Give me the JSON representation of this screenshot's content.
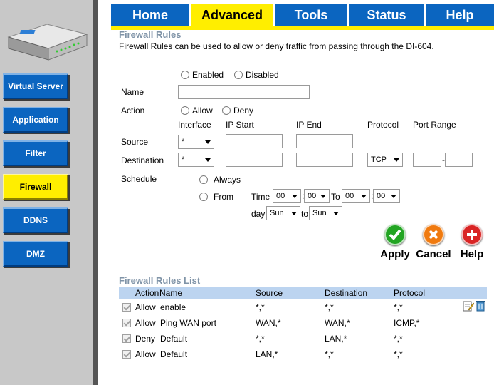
{
  "tabs": [
    {
      "label": "Home",
      "active": false
    },
    {
      "label": "Advanced",
      "active": true
    },
    {
      "label": "Tools",
      "active": false
    },
    {
      "label": "Status",
      "active": false
    },
    {
      "label": "Help",
      "active": false
    }
  ],
  "sidebar": {
    "items": [
      {
        "label": "Virtual Server",
        "active": false
      },
      {
        "label": "Application",
        "active": false
      },
      {
        "label": "Filter",
        "active": false
      },
      {
        "label": "Firewall",
        "active": true
      },
      {
        "label": "DDNS",
        "active": false
      },
      {
        "label": "DMZ",
        "active": false
      }
    ]
  },
  "rules": {
    "title": "Firewall Rules",
    "description": "Firewall Rules can be used to allow or deny traffic from passing through the DI-604.",
    "enabled_label": "Enabled",
    "disabled_label": "Disabled",
    "name_label": "Name",
    "name_value": "",
    "action_label": "Action",
    "allow_label": "Allow",
    "deny_label": "Deny",
    "col_interface": "Interface",
    "col_ip_start": "IP Start",
    "col_ip_end": "IP End",
    "col_protocol": "Protocol",
    "col_port_range": "Port Range",
    "source_label": "Source",
    "destination_label": "Destination",
    "source_interface": "*",
    "dest_interface": "*",
    "dest_protocol": "TCP",
    "port_dash": "-",
    "schedule_label": "Schedule",
    "always_label": "Always",
    "from_label": "From",
    "time_label": "Time",
    "time_from_hour": "00",
    "time_from_min": "00",
    "to_label": "To",
    "time_to_hour": "00",
    "time_to_min": "00",
    "day_label": "day",
    "day_from": "Sun",
    "day_to_label": "to",
    "day_to": "Sun",
    "colon": ":"
  },
  "actions": {
    "apply": "Apply",
    "cancel": "Cancel",
    "help": "Help"
  },
  "list": {
    "title": "Firewall Rules List",
    "headers": {
      "action": "Action",
      "name": "Name",
      "source": "Source",
      "destination": "Destination",
      "protocol": "Protocol"
    },
    "rows": [
      {
        "action": "Allow",
        "name": "enable",
        "source": "*,*",
        "destination": "*,*",
        "protocol": "*,*"
      },
      {
        "action": "Allow",
        "name": "Ping WAN port",
        "source": "WAN,*",
        "destination": "WAN,*",
        "protocol": "ICMP,*"
      },
      {
        "action": "Deny",
        "name": "Default",
        "source": "*,*",
        "destination": "LAN,*",
        "protocol": "*,*"
      },
      {
        "action": "Allow",
        "name": "Default",
        "source": "LAN,*",
        "destination": "*,*",
        "protocol": "*,*"
      }
    ]
  },
  "colors": {
    "nav_blue": "#0b65c0",
    "active_yellow": "#ffee00",
    "section_title": "#7f93a7",
    "list_header_bg": "#bcd4f0"
  }
}
